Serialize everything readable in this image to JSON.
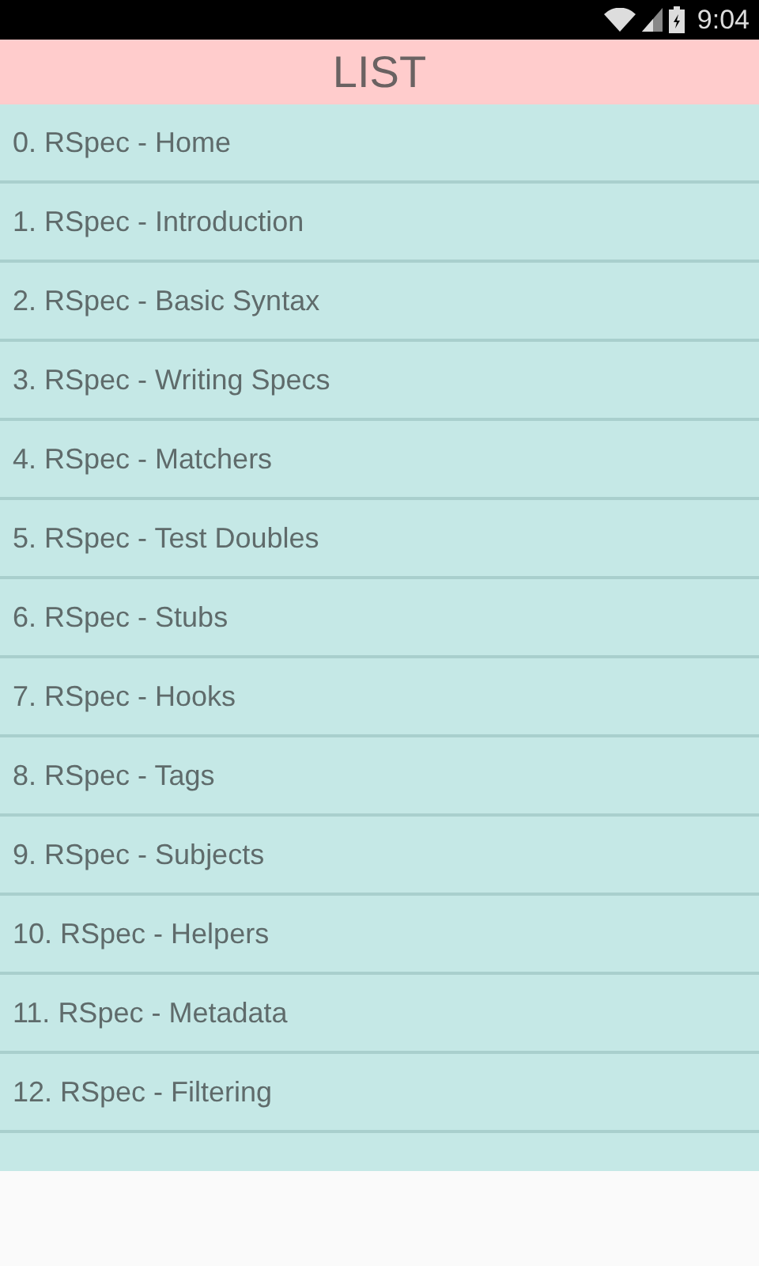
{
  "status_bar": {
    "time": "9:04"
  },
  "header": {
    "title": "LIST"
  },
  "items": [
    {
      "label": "0. RSpec - Home"
    },
    {
      "label": "1. RSpec - Introduction"
    },
    {
      "label": "2. RSpec - Basic Syntax"
    },
    {
      "label": "3. RSpec - Writing Specs"
    },
    {
      "label": "4. RSpec - Matchers"
    },
    {
      "label": "5. RSpec - Test Doubles"
    },
    {
      "label": "6. RSpec - Stubs"
    },
    {
      "label": "7. RSpec - Hooks"
    },
    {
      "label": "8. RSpec - Tags"
    },
    {
      "label": "9. RSpec - Subjects"
    },
    {
      "label": "10. RSpec - Helpers"
    },
    {
      "label": "11. RSpec - Metadata"
    },
    {
      "label": "12. RSpec - Filtering"
    }
  ]
}
